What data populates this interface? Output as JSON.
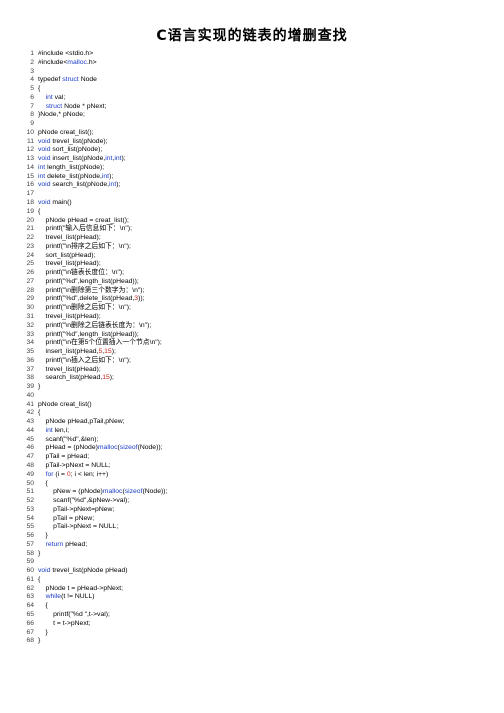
{
  "title": "C语言实现的链表的增删查找",
  "code_lines": [
    {
      "n": "1",
      "t": "#include <stdio.h>"
    },
    {
      "n": "2",
      "t": "#include<malloc.h>"
    },
    {
      "n": "3",
      "t": ""
    },
    {
      "n": "4",
      "t": "typedef struct Node"
    },
    {
      "n": "5",
      "t": "{"
    },
    {
      "n": "6",
      "t": "    int val;"
    },
    {
      "n": "7",
      "t": "    struct Node * pNext;"
    },
    {
      "n": "8",
      "t": "}Node,* pNode;"
    },
    {
      "n": "9",
      "t": ""
    },
    {
      "n": "10",
      "t": "pNode creat_list();"
    },
    {
      "n": "11",
      "t": "void trevel_list(pNode);"
    },
    {
      "n": "12",
      "t": "void sort_list(pNode);"
    },
    {
      "n": "13",
      "t": "void insert_list(pNode,int,int);"
    },
    {
      "n": "14",
      "t": "int length_list(pNode);"
    },
    {
      "n": "15",
      "t": "int delete_list(pNode,int);"
    },
    {
      "n": "16",
      "t": "void search_list(pNode,int);"
    },
    {
      "n": "17",
      "t": ""
    },
    {
      "n": "18",
      "t": "void main()"
    },
    {
      "n": "19",
      "t": "{"
    },
    {
      "n": "20",
      "t": "    pNode pHead = creat_list();"
    },
    {
      "n": "21",
      "t": "    printf(\"输入后信息如下：\\n\");"
    },
    {
      "n": "22",
      "t": "    trevel_list(pHead);"
    },
    {
      "n": "23",
      "t": "    printf(\"\\n排序之后如下：\\n\");"
    },
    {
      "n": "24",
      "t": "    sort_list(pHead);"
    },
    {
      "n": "25",
      "t": "    trevel_list(pHead);"
    },
    {
      "n": "26",
      "t": "    printf(\"\\n链表长度位：\\n\");"
    },
    {
      "n": "27",
      "t": "    printf(\"%d\",length_list(pHead));"
    },
    {
      "n": "28",
      "t": "    printf(\"\\n删除第三个数字为：\\n\");"
    },
    {
      "n": "29",
      "t": "    printf(\"%d\",delete_list(pHead,3));"
    },
    {
      "n": "30",
      "t": "    printf(\"\\n删除之后如下：\\n\");"
    },
    {
      "n": "31",
      "t": "    trevel_list(pHead);"
    },
    {
      "n": "32",
      "t": "    printf(\"\\n删除之后链表长度为：\\n\");"
    },
    {
      "n": "33",
      "t": "    printf(\"%d\",length_list(pHead));"
    },
    {
      "n": "34",
      "t": "    printf(\"\\n在第5个位置插入一个节点\\n\");"
    },
    {
      "n": "35",
      "t": "    insert_list(pHead,5,15);"
    },
    {
      "n": "36",
      "t": "    printf(\"\\n插入之后如下：\\n\");"
    },
    {
      "n": "37",
      "t": "    trevel_list(pHead);"
    },
    {
      "n": "38",
      "t": "    search_list(pHead,15);"
    },
    {
      "n": "39",
      "t": "}"
    },
    {
      "n": "40",
      "t": ""
    },
    {
      "n": "41",
      "t": "pNode creat_list()"
    },
    {
      "n": "42",
      "t": "{"
    },
    {
      "n": "43",
      "t": "    pNode pHead,pTail,pNew;"
    },
    {
      "n": "44",
      "t": "    int len,i;"
    },
    {
      "n": "45",
      "t": "    scanf(\"%d\",&len);"
    },
    {
      "n": "46",
      "t": "    pHead = (pNode)malloc(sizeof(Node));"
    },
    {
      "n": "47",
      "t": "    pTail = pHead;"
    },
    {
      "n": "48",
      "t": "    pTail->pNext = NULL;"
    },
    {
      "n": "49",
      "t": "    for (i = 0; i < len; i++)"
    },
    {
      "n": "50",
      "t": "    {"
    },
    {
      "n": "51",
      "t": "        pNew = (pNode)malloc(sizeof(Node));"
    },
    {
      "n": "52",
      "t": "        scanf(\"%d\",&pNew->val);"
    },
    {
      "n": "53",
      "t": "        pTail->pNext=pNew;"
    },
    {
      "n": "54",
      "t": "        pTail = pNew;"
    },
    {
      "n": "55",
      "t": "        pTail->pNext = NULL;"
    },
    {
      "n": "56",
      "t": "    }"
    },
    {
      "n": "57",
      "t": "    return pHead;"
    },
    {
      "n": "58",
      "t": "}"
    },
    {
      "n": "59",
      "t": ""
    },
    {
      "n": "60",
      "t": "void trevel_list(pNode pHead)"
    },
    {
      "n": "61",
      "t": "{"
    },
    {
      "n": "62",
      "t": "    pNode t = pHead->pNext;"
    },
    {
      "n": "63",
      "t": "    while(t != NULL)"
    },
    {
      "n": "64",
      "t": "    {"
    },
    {
      "n": "65",
      "t": "        printf(\"%d \",t->val);"
    },
    {
      "n": "66",
      "t": "        t = t->pNext;"
    },
    {
      "n": "67",
      "t": "    }"
    },
    {
      "n": "68",
      "t": "}"
    }
  ]
}
